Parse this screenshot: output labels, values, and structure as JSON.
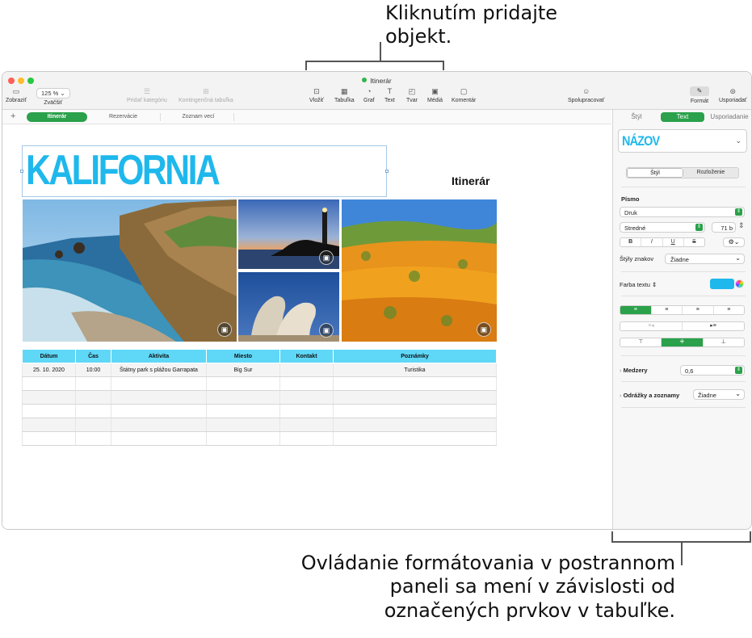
{
  "callouts": {
    "top": [
      "Kliknutím pridajte",
      "objekt."
    ],
    "bottom": [
      "Ovládanie formátovania v postrannom",
      "paneli sa mení v závislosti od",
      "označených prvkov v tabuľke."
    ]
  },
  "window": {
    "title": "Itinerár"
  },
  "toolbar": {
    "view": "Zobraziť",
    "zoom_value": "125 %",
    "zoom": "Zväčšiť",
    "add_category": "Pridať kategóriu",
    "pivot_table": "Kontingenčná tabuľka",
    "insert": "Vložiť",
    "table": "Tabuľka",
    "chart": "Graf",
    "text": "Text",
    "shape": "Tvar",
    "media": "Médiá",
    "comment": "Komentár",
    "collaborate": "Spolupracovať",
    "format": "Formát",
    "organize": "Usporiadať"
  },
  "sheet_tabs": [
    "Itinerár",
    "Rezervácie",
    "Zoznam vecí"
  ],
  "canvas": {
    "title": "KALIFORNIA",
    "heading": "Itinerár"
  },
  "table": {
    "headers": [
      "Dátum",
      "Čas",
      "Aktivita",
      "Miesto",
      "Kontakt",
      "Poznámky"
    ],
    "rows": [
      [
        "25. 10. 2020",
        "10:00",
        "Štátny park s plážou Garrapata",
        "Big Sur",
        "",
        "Turistika"
      ],
      [
        "",
        "",
        "",
        "",
        "",
        ""
      ],
      [
        "",
        "",
        "",
        "",
        "",
        ""
      ],
      [
        "",
        "",
        "",
        "",
        "",
        ""
      ],
      [
        "",
        "",
        "",
        "",
        "",
        ""
      ],
      [
        "",
        "",
        "",
        "",
        "",
        ""
      ]
    ]
  },
  "sidebar": {
    "tabs": [
      "Štýl",
      "Text",
      "Usporiadanie"
    ],
    "style_preview": "NÁZOV",
    "subtabs": [
      "Štýl",
      "Rozloženie"
    ],
    "font_label": "Písmo",
    "font_name": "Druk",
    "font_style": "Stredné",
    "font_size": "71 b",
    "bold": "B",
    "italic": "I",
    "underline": "U",
    "strike": "S",
    "char_styles_label": "Štýly znakov",
    "char_styles_value": "Žiadne",
    "text_color_label": "Farba textu",
    "text_color": "#1fb8ec",
    "spacing_label": "Medzery",
    "spacing_value": "0,6",
    "bullets_label": "Odrážky a zoznamy",
    "bullets_value": "Žiadne"
  }
}
